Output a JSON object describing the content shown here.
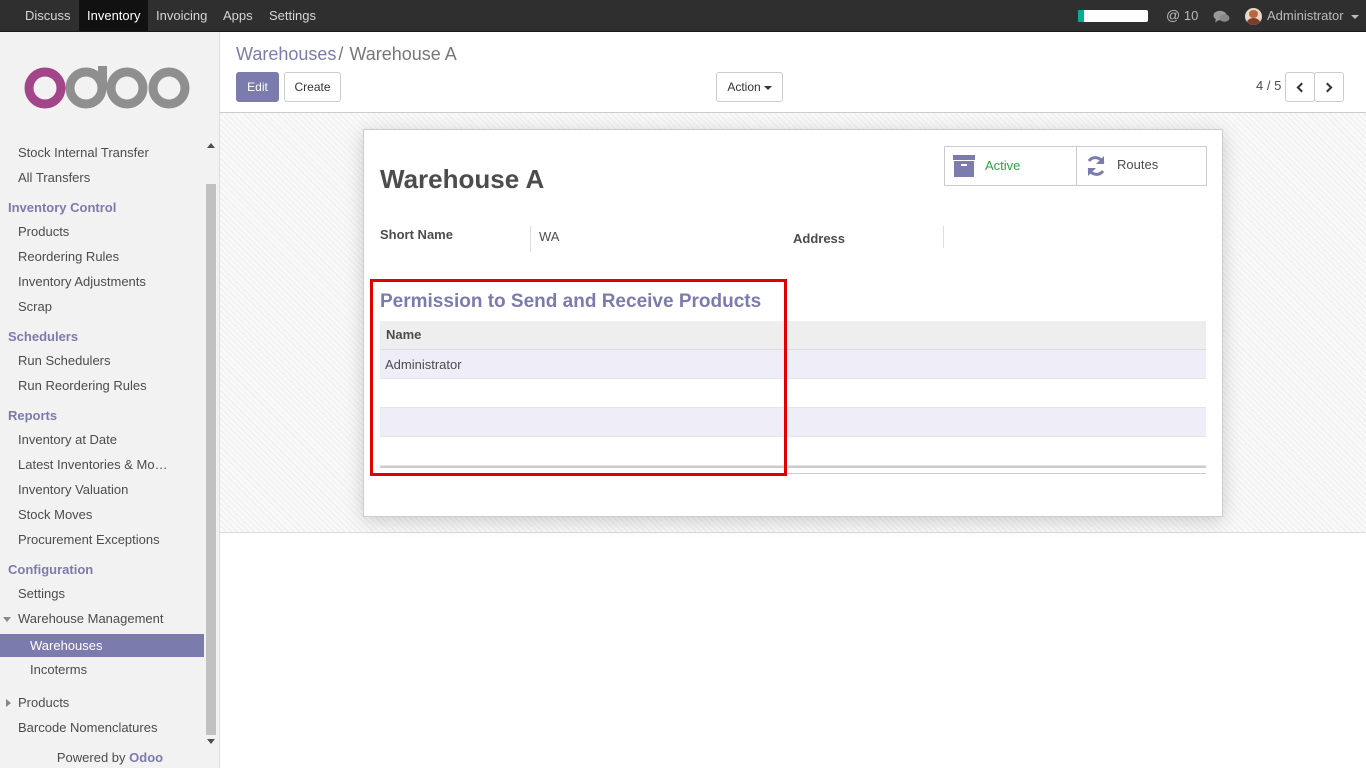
{
  "topbar": {
    "apps": [
      "Discuss",
      "Inventory",
      "Invoicing",
      "Apps",
      "Settings"
    ],
    "active_app": "Inventory",
    "progress": 0.08,
    "mentions_count": "10",
    "user_name": "Administrator"
  },
  "sidebar": {
    "sections": {
      "transfers": [
        "Stock Internal Transfer",
        "All Transfers"
      ],
      "inventory_control": {
        "title": "Inventory Control",
        "items": [
          "Products",
          "Reordering Rules",
          "Inventory Adjustments",
          "Scrap"
        ]
      },
      "schedulers": {
        "title": "Schedulers",
        "items": [
          "Run Schedulers",
          "Run Reordering Rules"
        ]
      },
      "reports": {
        "title": "Reports",
        "items": [
          "Inventory at Date",
          "Latest Inventories & Moves",
          "Inventory Valuation",
          "Stock Moves",
          "Procurement Exceptions"
        ]
      },
      "configuration": {
        "title": "Configuration",
        "settings": "Settings",
        "warehouse_management": "Warehouse Management",
        "warehouses": "Warehouses",
        "incoterms": "Incoterms",
        "products": "Products",
        "barcode": "Barcode Nomenclatures"
      }
    },
    "powered_by": "Powered by",
    "powered_brand": "Odoo"
  },
  "control_panel": {
    "breadcrumb_parent": "Warehouses",
    "breadcrumb_sep": "/",
    "breadcrumb_current": "Warehouse A",
    "edit_label": "Edit",
    "create_label": "Create",
    "action_label": "Action",
    "pager": "4 / 5"
  },
  "form": {
    "title": "Warehouse A",
    "active_label": "Active",
    "routes_label": "Routes",
    "short_name_label": "Short Name",
    "short_name_value": "WA",
    "address_label": "Address",
    "section_title": "Permission to Send and Receive Products",
    "table_header": "Name",
    "rows": [
      "Administrator",
      "",
      "",
      ""
    ]
  },
  "colors": {
    "brand": "#7c7bad",
    "active_green": "#28a745",
    "highlight": "#e00000"
  }
}
